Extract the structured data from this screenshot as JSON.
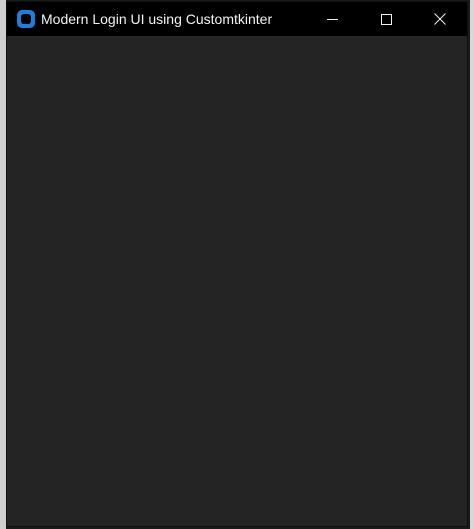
{
  "window": {
    "title": "Modern Login UI using Customtkinter",
    "controls": {
      "minimize_icon": "minimize-icon",
      "maximize_icon": "maximize-icon",
      "close_icon": "close-icon"
    }
  },
  "colors": {
    "titlebar": "#000000",
    "background": "#242424",
    "title_text": "#f3f3f3",
    "app_icon": "#1e7fd7"
  }
}
